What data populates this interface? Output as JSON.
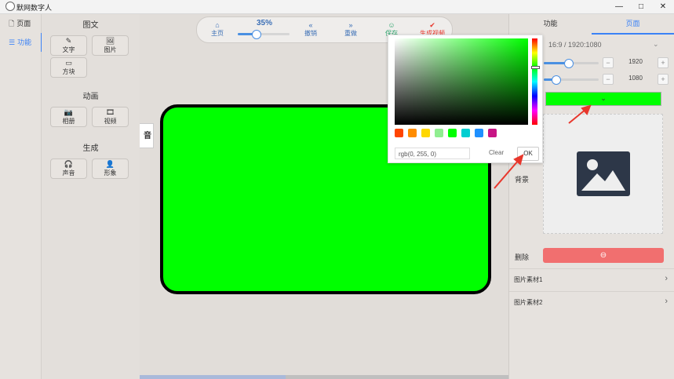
{
  "window": {
    "title": "默网数字人",
    "minimize": "—",
    "maximize": "□",
    "close": "✕"
  },
  "nav": {
    "items": [
      {
        "icon": "🗋",
        "label": "页面",
        "active": false
      },
      {
        "icon": "☰",
        "label": "功能",
        "active": true
      }
    ]
  },
  "palette": {
    "sections": [
      {
        "title": "图文",
        "tools": [
          {
            "icon": "✎",
            "label": "文字"
          },
          {
            "icon": "🖼",
            "label": "图片"
          },
          {
            "icon": "▭",
            "label": "方块"
          }
        ]
      },
      {
        "title": "动画",
        "tools": [
          {
            "icon": "📷",
            "label": "相册"
          },
          {
            "icon": "🎞",
            "label": "视频"
          }
        ]
      },
      {
        "title": "生成",
        "tools": [
          {
            "icon": "🎧",
            "label": "声音"
          },
          {
            "icon": "👤",
            "label": "形象"
          }
        ]
      }
    ]
  },
  "toolbar": {
    "home": {
      "icon": "⌂",
      "label": "主页"
    },
    "zoom_label": "35%",
    "zoom_value": 0.35,
    "undo": {
      "icon": "«",
      "label": "撤销"
    },
    "redo": {
      "icon": "»",
      "label": "重做"
    },
    "save": {
      "icon": "☺",
      "label": "保存"
    },
    "generate": {
      "icon": "✔",
      "label": "生成视频"
    }
  },
  "canvas": {
    "side_tab": "音",
    "background_color": "#00ff00"
  },
  "right_panel": {
    "tabs": [
      {
        "label": "功能",
        "active": false
      },
      {
        "label": "页面",
        "active": true
      }
    ],
    "ratio": "16:9 / 1920:1080",
    "width": {
      "value": "1920",
      "level": 0.44
    },
    "height": {
      "value": "1080",
      "level": 0.21
    },
    "color_chevron": "⌄",
    "background_label": "背景",
    "delete_label": "删除",
    "delete_icon": "⊖",
    "accordions": [
      {
        "label": "图片素材1"
      },
      {
        "label": "图片素材2"
      }
    ]
  },
  "color_picker": {
    "value": "rgb(0, 255, 0)",
    "clear_label": "Clear",
    "ok_label": "OK",
    "hue_level": 0.33,
    "swatches": [
      "#ff4500",
      "#ff8c00",
      "#ffd700",
      "#90ee90",
      "#00ff00",
      "#00ced1",
      "#1e90ff",
      "#c71585"
    ]
  },
  "colors": {
    "accent": "#3b82f6",
    "green": "#00ff00",
    "danger": "#f16f6f",
    "annotation": "#e8372c"
  }
}
